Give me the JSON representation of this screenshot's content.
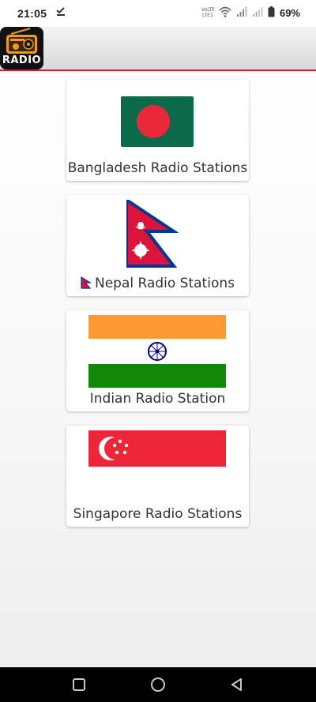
{
  "status_bar": {
    "time": "21:05",
    "battery": "69%",
    "icons": [
      "download-done-icon",
      "volte-icon",
      "wifi-icon",
      "signal-icon",
      "signal-icon",
      "battery-icon"
    ]
  },
  "app": {
    "logo_text": "RADIO",
    "accent_color": "#d3202a"
  },
  "stations": [
    {
      "label": "Bangladesh Radio Stations",
      "flag": "bangladesh-flag-icon"
    },
    {
      "label": "Nepal Radio Stations",
      "flag": "nepal-flag-icon"
    },
    {
      "label": "Indian Radio Station",
      "flag": "india-flag-icon"
    },
    {
      "label": "Singapore Radio Stations",
      "flag": "singapore-flag-icon"
    }
  ],
  "nav_bar": {
    "buttons": [
      "recents-square-icon",
      "home-circle-icon",
      "back-triangle-icon"
    ]
  }
}
